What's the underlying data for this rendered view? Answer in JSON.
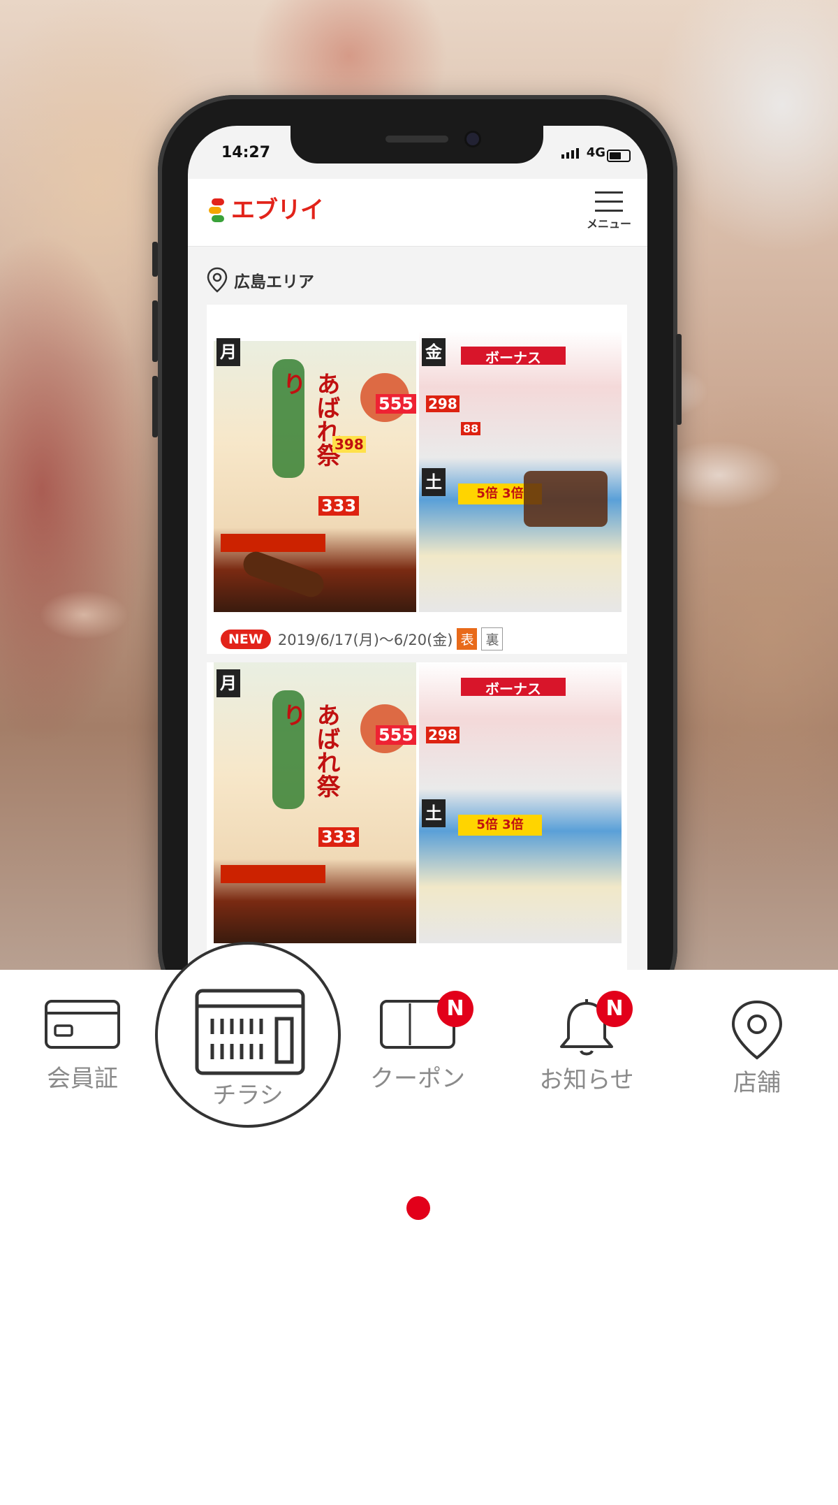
{
  "status_bar": {
    "time": "14:27",
    "network": "4G"
  },
  "app": {
    "logo_text": "エブリイ",
    "menu_label": "メニュー"
  },
  "area": {
    "label": "広島エリア"
  },
  "flyers": [
    {
      "badge": "NEW",
      "period": "2019/6/17(月)〜6/20(金)",
      "front_label": "表",
      "back_label": "裏"
    }
  ],
  "flyer_art": {
    "left_days": [
      "月",
      "土"
    ],
    "prices": [
      "555",
      "398",
      "333",
      "298",
      "88"
    ],
    "headline": "あばれ祭り",
    "bonus": "ボーナス",
    "points": "5倍 3倍"
  },
  "nav": {
    "items": [
      {
        "label": "会員証",
        "icon": "membership-card-icon"
      },
      {
        "label": "チラシ",
        "icon": "flyer-icon",
        "active": true
      },
      {
        "label": "クーポン",
        "icon": "coupon-icon",
        "badge": "N"
      },
      {
        "label": "お知らせ",
        "icon": "bell-icon",
        "badge": "N"
      },
      {
        "label": "店舗",
        "icon": "location-pin-icon"
      }
    ]
  },
  "colors": {
    "brand_red": "#e2231a",
    "badge_red": "#e2001a",
    "tag_orange": "#e86a1a"
  }
}
